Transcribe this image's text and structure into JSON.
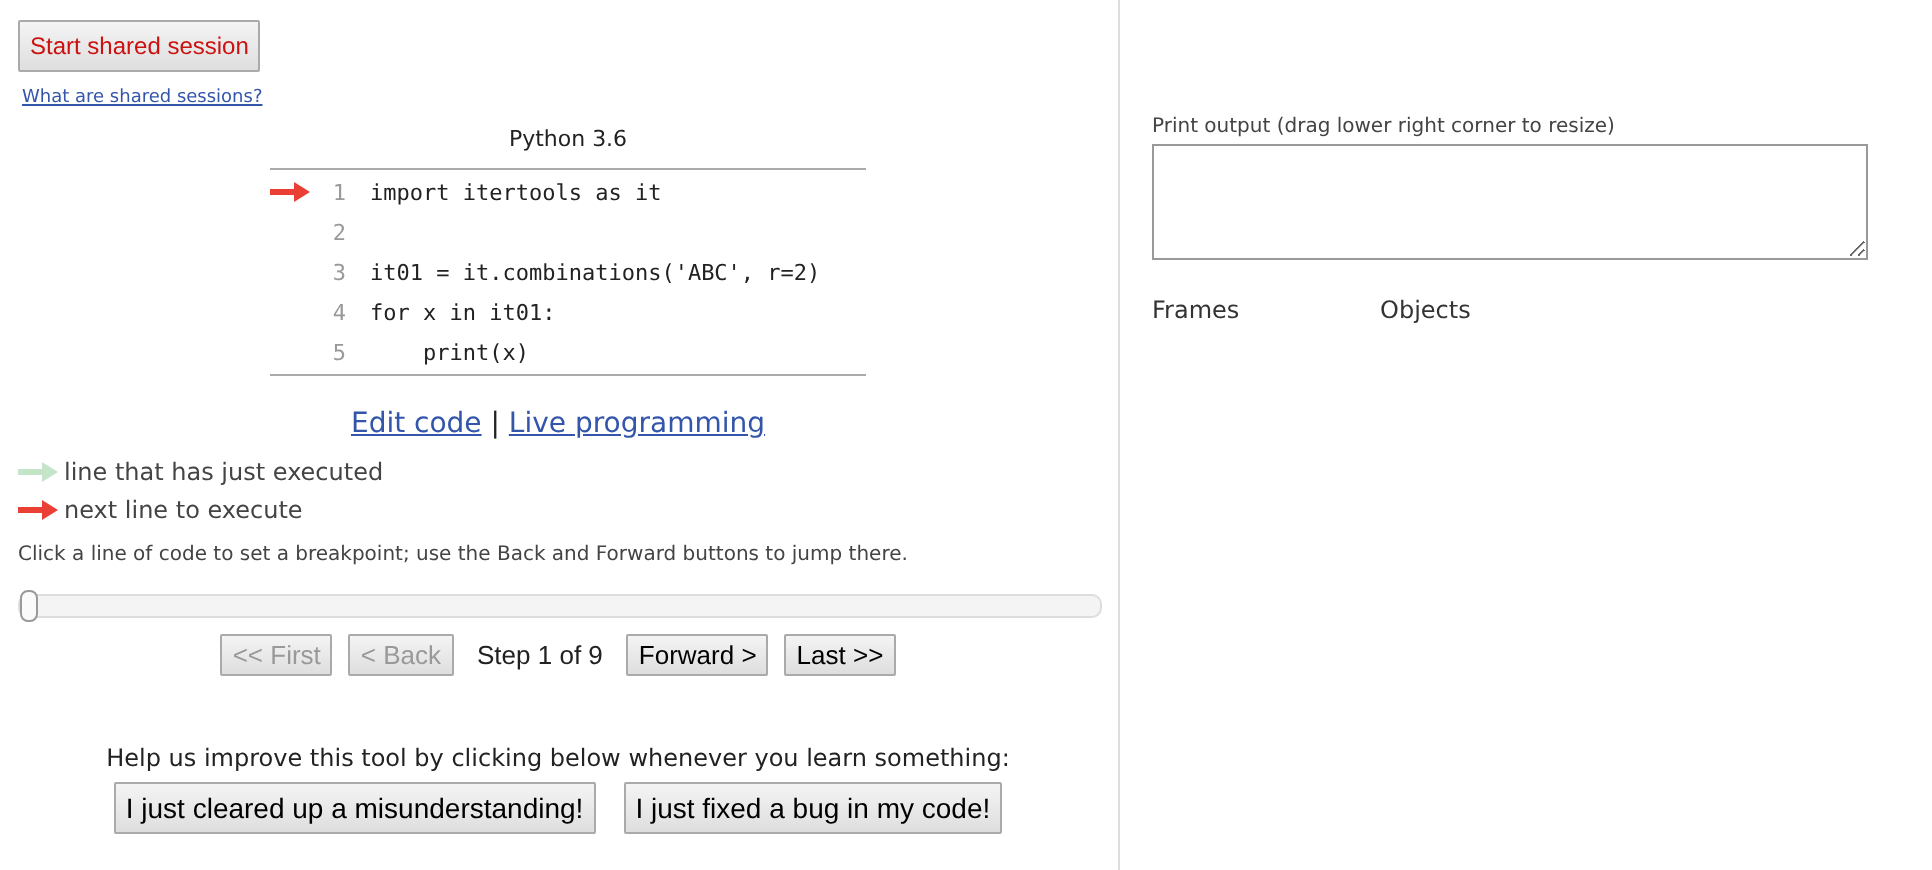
{
  "session": {
    "button": "Start shared session",
    "link": "What are shared sessions?"
  },
  "code": {
    "language": "Python 3.6",
    "lines": [
      {
        "number": "1",
        "text": "import itertools as it",
        "next_line": true
      },
      {
        "number": "2",
        "next_line": false
      },
      {
        "number": "3",
        "text": "it01 = it.combinations('ABC', r=2)",
        "next_line": false
      },
      {
        "number": "4",
        "text": "for x in it01:",
        "next_line": false
      },
      {
        "number": "5",
        "text": "    print(x)",
        "next_line": false
      }
    ]
  },
  "edit_links": {
    "edit": "Edit code",
    "separator": "|",
    "live": "Live programming"
  },
  "legend": [
    {
      "kind": "executed",
      "label": "line that has just executed"
    },
    {
      "kind": "next",
      "label": "next line to execute"
    }
  ],
  "hint": "Click a line of code to set a breakpoint; use the Back and Forward buttons to jump there.",
  "slider": {
    "level": 0
  },
  "navigation": {
    "buttons": [
      {
        "label": "<< First",
        "disabled": true
      },
      {
        "label": "< Back",
        "disabled": true
      },
      {
        "label": "Forward >",
        "disabled": false
      },
      {
        "label": "Last >>",
        "disabled": false
      }
    ],
    "step": "Step 1 of 9"
  },
  "feedback": {
    "prompt": "Help us improve this tool by clicking below whenever you learn something:",
    "buttons": [
      "I just cleared up a misunderstanding!",
      "I just fixed a bug in my code!"
    ]
  },
  "output": {
    "label": "Print output (drag lower right corner to resize)"
  },
  "headers": {
    "frames": "Frames",
    "objects": "Objects"
  }
}
